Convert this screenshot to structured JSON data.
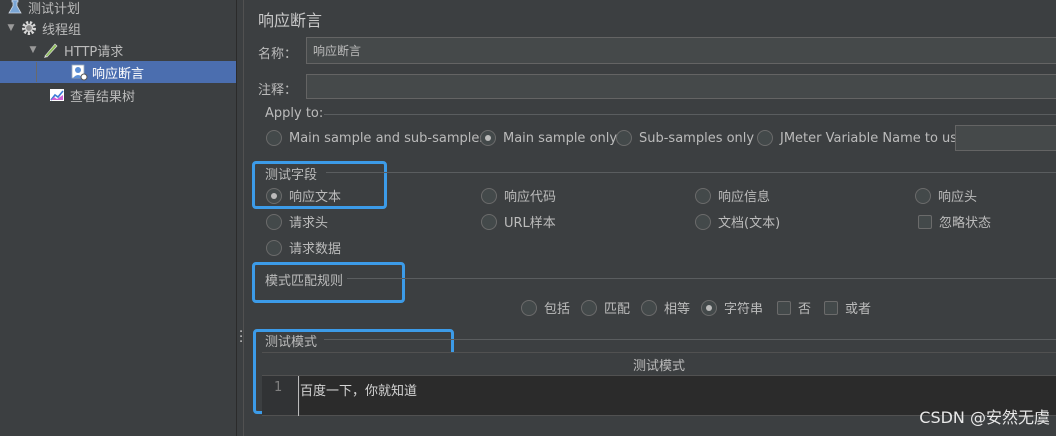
{
  "tree": {
    "items": [
      {
        "label": "测试计划",
        "icon": "test-plan-icon"
      },
      {
        "label": "线程组",
        "icon": "gear-icon"
      },
      {
        "label": "HTTP请求",
        "icon": "pen-icon"
      },
      {
        "label": "响应断言",
        "icon": "assertion-icon"
      },
      {
        "label": "查看结果树",
        "icon": "chart-icon"
      }
    ]
  },
  "panel": {
    "title": "响应断言",
    "name_label": "名称：",
    "name_value": "响应断言",
    "comment_label": "注释：",
    "comment_value": "",
    "apply_to": {
      "label": "Apply to:",
      "options": [
        "Main sample and sub-samples",
        "Main sample only",
        "Sub-samples only",
        "JMeter Variable Name to use"
      ],
      "selected": "Main sample only",
      "variable_value": ""
    },
    "test_field": {
      "label": "测试字段",
      "options": [
        "响应文本",
        "响应代码",
        "响应信息",
        "响应头",
        "请求头",
        "URL样本",
        "文档(文本)",
        "请求数据"
      ],
      "selected": "响应文本",
      "ignore_status_label": "忽略状态",
      "ignore_status_checked": false
    },
    "pattern_rules": {
      "label": "模式匹配规则",
      "radio_options": [
        "包括",
        "匹配",
        "相等",
        "字符串"
      ],
      "selected": "字符串",
      "not_label": "否",
      "or_label": "或者"
    },
    "test_patterns": {
      "label": "测试模式",
      "column_header": "测试模式",
      "line_number": "1",
      "line_text": "百度一下，你就知道"
    }
  },
  "watermark": "CSDN @安然无虞",
  "colors": {
    "highlight": "#3c9be8",
    "selection": "#4b6eaf",
    "background": "#3c3f41"
  }
}
